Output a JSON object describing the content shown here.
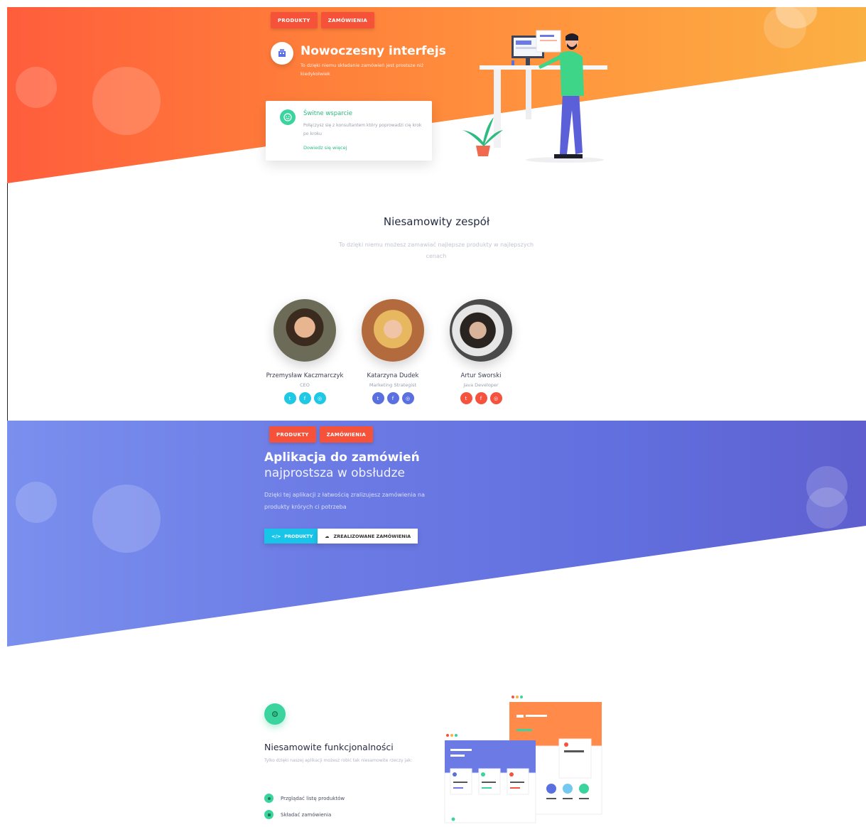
{
  "nav": {
    "tab_products": "PRODUKTY",
    "tab_orders": "ZAMÓWIENIA"
  },
  "hero": {
    "title": "Nowoczesny interfejs",
    "subtitle": "To dzięki niemu składanie zamówień jest prostsze niż kiedykolwiek",
    "support_card": {
      "title": "Świtne wsparcie",
      "text": "Połączysz się z konsultantem który poprowadzi cię krok po kroku",
      "link": "Dowiedz się więcej"
    }
  },
  "team": {
    "title": "Niesamowity zespół",
    "subtitle": "To dzięki niemu możesz zamawiać najlepsze produkty w najlepszych cenach",
    "members": [
      {
        "name": "Przemysław Kaczmarczyk",
        "role": "CEO",
        "social_color": "#1fc8e5"
      },
      {
        "name": "Katarzyna Dudek",
        "role": "Marketing Strategist",
        "social_color": "#5b70e0"
      },
      {
        "name": "Artur Sworski",
        "role": "Java Developer",
        "social_color": "#f5533d"
      }
    ],
    "social_glyphs": [
      "t",
      "f",
      "◎"
    ]
  },
  "app": {
    "title_line1": "Aplikacja do zamówień",
    "title_line2": "najprostsza w obsłudze",
    "text": "Dzięki tej aplikacji z łatwością zralizujesz zamówienia na produkty krórych ci potrzeba",
    "btn_products": "PRODUKTY",
    "btn_orders": "ZREALIZOWANE ZAMÓWIENIA"
  },
  "features": {
    "title": "Niesamowite funkcjonalności",
    "subtitle": "Tylko dzięki naszej aplikacji możesz robić tak niesamowite rzeczy jak:",
    "items": [
      "Przglądać listę produktów",
      "Składać zamówienia"
    ]
  },
  "colors": {
    "orange": "#ff7e3a",
    "blue": "#6b7ae4",
    "green": "#3bd39e",
    "cyan": "#18c5e8",
    "tab_red": "#f6523a"
  }
}
